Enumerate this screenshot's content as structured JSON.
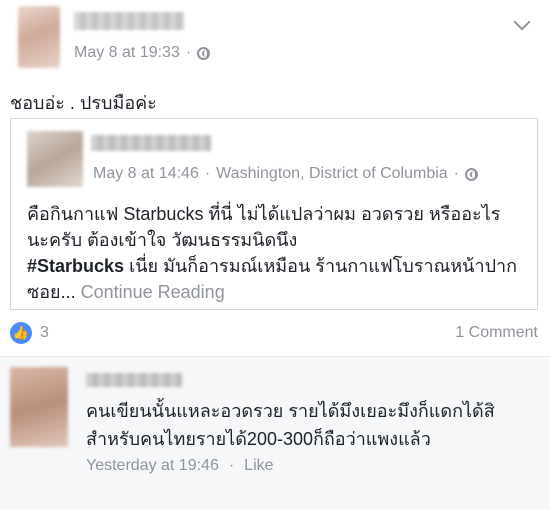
{
  "post": {
    "timestamp": "May 8 at 19:33",
    "privacy_icon": "globe-icon",
    "status_text": "ชอบอ่ะ . ปรบมือค่ะ"
  },
  "shared": {
    "timestamp": "May 8 at 14:46",
    "location": "Washington, District of Columbia",
    "privacy_icon": "globe-icon",
    "body_line1": "คือกินกาแฟ Starbucks ที่นี่ ไม่ได้แปลว่าผม อวดรวย หรืออะไร",
    "body_line2": "นะครับ ต้องเข้าใจ วัฒนธรรมนิดนึง",
    "hashtag": "#Starbucks",
    "body_line3": " เนี่ย มันก็อารมณ์เหมือน ร้านกาแฟโบราณหน้าปาก",
    "body_line4": "ซอย...",
    "continue_reading": "Continue Reading"
  },
  "reactions": {
    "count": "3",
    "comments_label": "1 Comment"
  },
  "comment": {
    "text_line1": "คนเขียนนั้นแหละอวดรวย รายได้มึงเยอะมึงก็แดกได้สิ",
    "text_line2": "สำหรับคนไทยรายได้200-300ก็ถือว่าแพงแล้ว",
    "timestamp": "Yesterday at 19:46",
    "like_label": "Like"
  },
  "colors": {
    "like_blue": "#4a8cf7",
    "meta_gray": "#90949c",
    "text": "#1d2129"
  }
}
